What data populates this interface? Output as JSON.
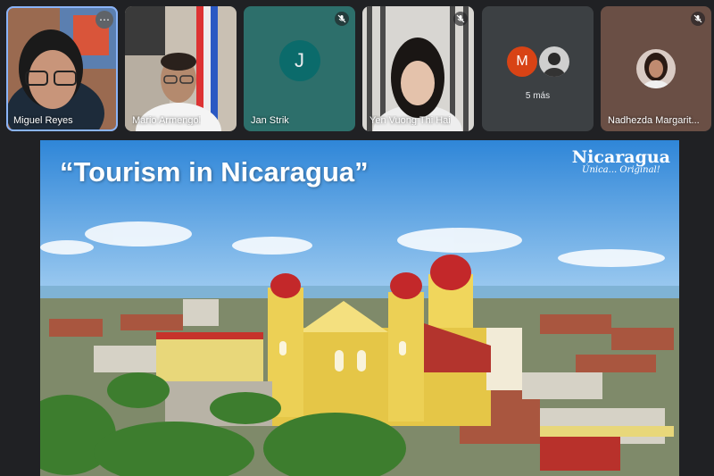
{
  "participants": [
    {
      "name": "Miguel Reyes",
      "active": true,
      "more_icon": "⋯"
    },
    {
      "name": "Mario Armengol"
    },
    {
      "name": "Jan Strik",
      "initial": "J",
      "muted": true
    },
    {
      "name": "Yen Vuong Thi Hai",
      "muted": true
    },
    {
      "initial": "M",
      "more_label": "5 más"
    },
    {
      "name": "Nadhezda Margarit...",
      "muted": true
    }
  ],
  "slide": {
    "title": "“Tourism in Nicaragua”",
    "logo_main": "Nicaragua",
    "logo_sub": "Única... Original!"
  },
  "colors": {
    "background": "#202124",
    "tile": "#3c4043",
    "active_outline": "#8ab4f8",
    "avatar_teal": "#0b6b6b",
    "avatar_orange": "#d84315"
  },
  "icons": {
    "muted": "mic-off-icon",
    "more": "more-options-icon"
  }
}
